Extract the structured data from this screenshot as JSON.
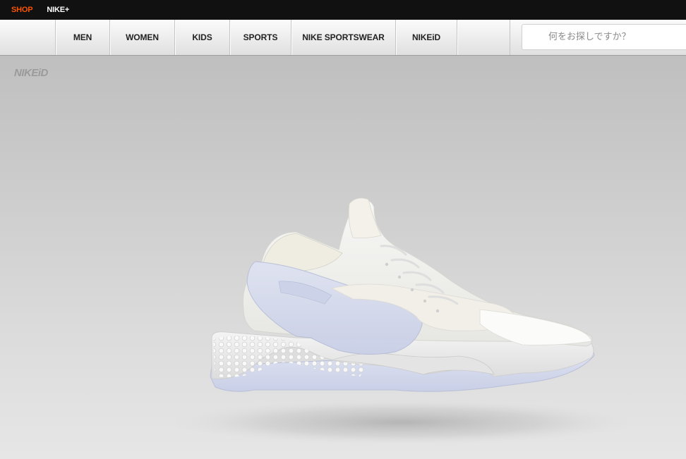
{
  "topbar": {
    "shop_label": "SHOP",
    "nikeplus_label": "NIKE+"
  },
  "nav": {
    "items": [
      {
        "label": "MEN"
      },
      {
        "label": "WOMEN"
      },
      {
        "label": "KIDS"
      },
      {
        "label": "SPORTS"
      },
      {
        "label": "NIKE SPORTSWEAR"
      },
      {
        "label": "NIKEiD"
      }
    ]
  },
  "search": {
    "placeholder": "何をお探しですか？",
    "value": ""
  },
  "stage": {
    "logo_text": "NIKEiD",
    "product_image": "white-running-shoe-side-view"
  },
  "colors": {
    "topbar_bg": "#111111",
    "shop_accent": "#fa5400",
    "nav_text": "#222222",
    "stage_bg": "#d0d0d0"
  }
}
